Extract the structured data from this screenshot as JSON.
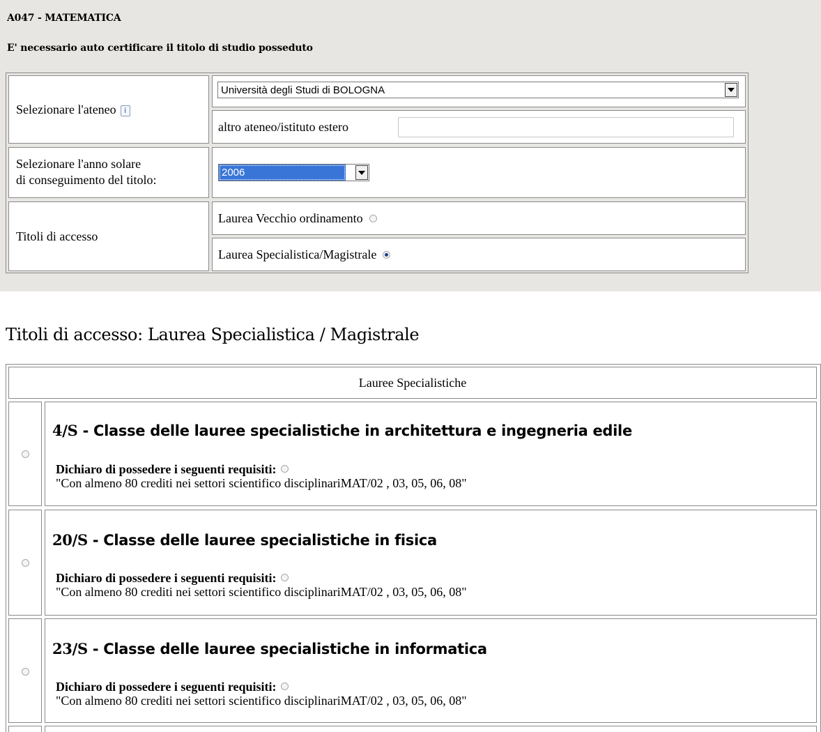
{
  "header": {
    "class_code": "A047 - MATEMATICA",
    "cert_notice": "E' necessario auto certificare il titolo di studio posseduto"
  },
  "form": {
    "ateneo_label": "Selezionare l'ateneo",
    "ateneo_info_icon": "info-icon",
    "ateneo_selected": "Università degli Studi di BOLOGNA",
    "altro_label": "altro ateneo/istituto estero",
    "altro_value": "",
    "anno_label_line1": "Selezionare l'anno solare",
    "anno_label_line2": "di conseguimento del titolo:",
    "anno_selected": "2006",
    "titoli_label": "Titoli di accesso",
    "option_vecchio": "Laurea Vecchio ordinamento",
    "option_vecchio_checked": false,
    "option_specialistica": "Laurea Specialistica/Magistrale",
    "option_specialistica_checked": true
  },
  "section": {
    "title": "Titoli di accesso: Laurea Specialistica / Magistrale",
    "table_header": "Lauree Specialistiche",
    "degrees": [
      {
        "code": "4/S",
        "name": " - Classe delle lauree specialistiche in architettura e ingegneria edile",
        "declaration": "Dichiaro di possedere i seguenti requisiti:",
        "requirement": "\"Con almeno 80 crediti nei settori scientifico disciplinariMAT/02 , 03, 05, 06, 08\""
      },
      {
        "code": "20/S",
        "name": " - Classe delle lauree specialistiche in fisica",
        "declaration": "Dichiaro di possedere i seguenti requisiti:",
        "requirement": "\"Con almeno 80 crediti nei settori scientifico disciplinariMAT/02 , 03, 05, 06, 08\""
      },
      {
        "code": "23/S",
        "name": " - Classe delle lauree specialistiche in informatica",
        "declaration": "Dichiaro di possedere i seguenti requisiti:",
        "requirement": "\"Con almeno 80 crediti nei settori scientifico disciplinariMAT/02 , 03, 05, 06, 08\""
      }
    ]
  },
  "colors": {
    "top_background": "#e8e6e3",
    "selection_highlight": "#3875d7",
    "border": "#8a8a8a"
  }
}
